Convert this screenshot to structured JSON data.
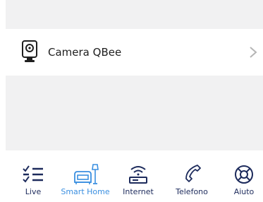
{
  "device_list": {
    "items": [
      {
        "title": "Camera QBee",
        "icon": "camera-icon",
        "chevron_icon": "chevron-right-icon"
      }
    ]
  },
  "tabbar": {
    "active_index": 1,
    "tabs": [
      {
        "label": "Live",
        "icon": "checklist-icon"
      },
      {
        "label": "Smart Home",
        "icon": "sofa-lamp-icon"
      },
      {
        "label": "Internet",
        "icon": "router-icon"
      },
      {
        "label": "Telefono",
        "icon": "phone-icon"
      },
      {
        "label": "Aiuto",
        "icon": "lifebuoy-icon"
      }
    ]
  },
  "colors": {
    "navy": "#1d2b5c",
    "active_blue": "#3a8fe0",
    "gray_bg": "#f1f1f2",
    "chevron": "#b5b5b5",
    "text": "#1f1f1f"
  }
}
